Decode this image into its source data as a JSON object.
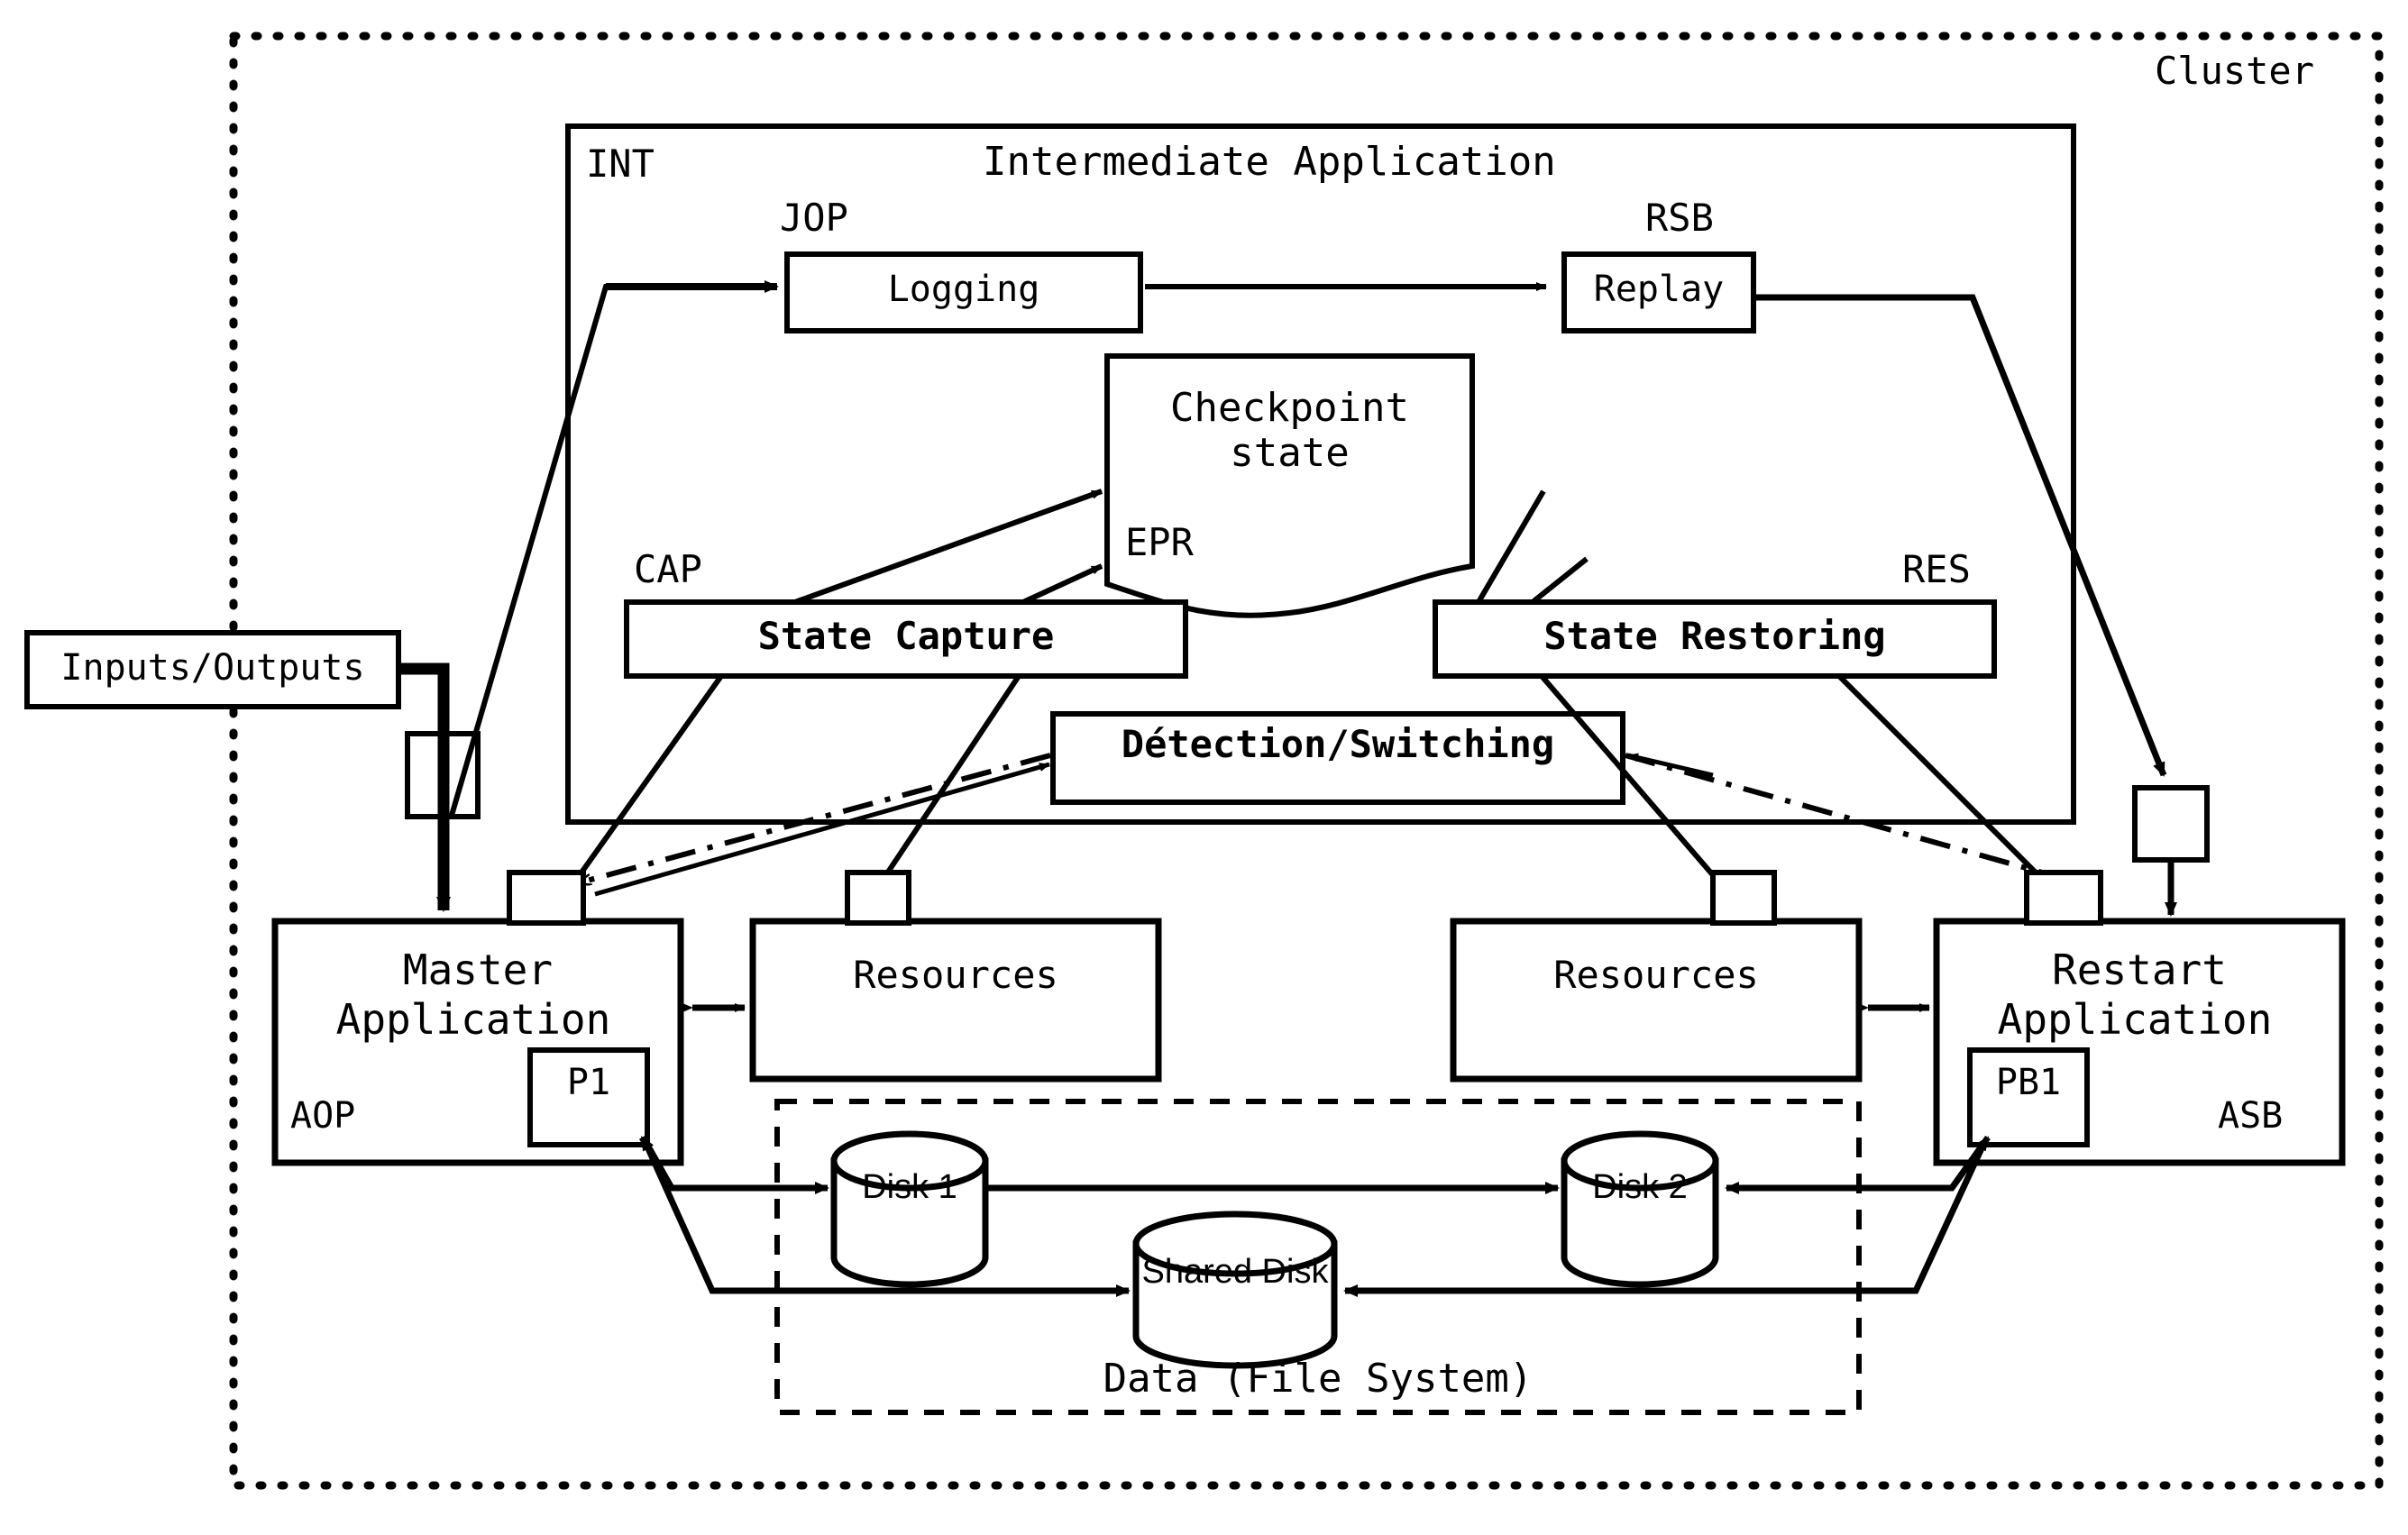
{
  "diagram": {
    "title_visible": false,
    "cluster": {
      "label": "Cluster"
    },
    "intermediate": {
      "tag": "INT",
      "title": "Intermediate Application",
      "logging": {
        "tag": "JOP",
        "label": "Logging"
      },
      "replay": {
        "tag": "RSB",
        "label": "Replay"
      },
      "checkpoint": {
        "tag": "EPR",
        "label_line1": "Checkpoint",
        "label_line2": "state"
      },
      "state_capture": {
        "tag": "CAP",
        "label": "State Capture"
      },
      "state_restoring": {
        "tag": "RES",
        "label": "State Restoring"
      },
      "detection": {
        "label": "Détection/Switching"
      }
    },
    "inputs_outputs": {
      "label": "Inputs/Outputs"
    },
    "master_application": {
      "tag": "AOP",
      "label_line1": "Master",
      "label_line2": "Application",
      "process": "P1"
    },
    "restart_application": {
      "tag": "ASB",
      "label_line1": "Restart",
      "label_line2": "Application",
      "process": "PB1"
    },
    "resources_left": {
      "label": "Resources"
    },
    "resources_right": {
      "label": "Resources"
    },
    "data_area": {
      "caption": "Data (File System)",
      "disk1": {
        "label": "Disk 1"
      },
      "disk2": {
        "label": "Disk 2"
      },
      "shared_disk": {
        "label": "Shared Disk"
      }
    },
    "colors": {
      "line": "#000000",
      "background": "#ffffff"
    }
  }
}
